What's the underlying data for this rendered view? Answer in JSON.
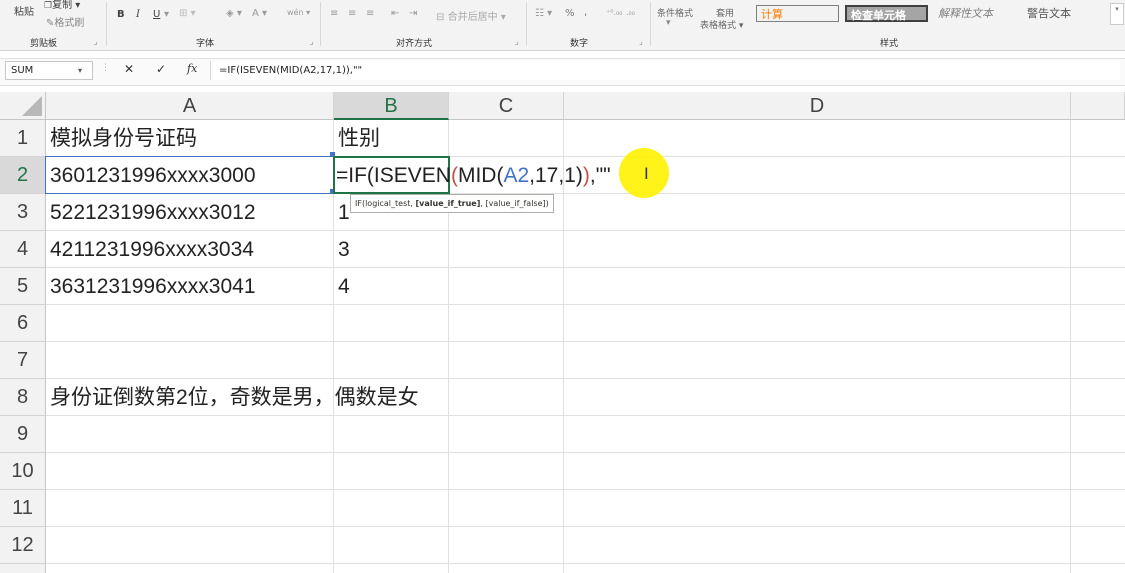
{
  "ribbon": {
    "clipboard": {
      "paste": "粘贴",
      "copy": "复制",
      "format_painter": "格式刷",
      "group_label": "剪贴板"
    },
    "font": {
      "bold": "B",
      "italic": "I",
      "underline": "U",
      "font_color": "A",
      "phonetic": "wén",
      "group_label": "字体"
    },
    "alignment": {
      "merge_center": "合并后居中",
      "group_label": "对齐方式"
    },
    "number": {
      "percent": "%",
      "comma": ",",
      "group_label": "数字"
    },
    "styles": {
      "conditional_format": "条件格式",
      "format_as_table_line1": "套用",
      "format_as_table_line2": "表格格式",
      "calc": "计算",
      "check_cell": "检查单元格",
      "explanatory": "解释性文本",
      "warning": "警告文本",
      "group_label": "样式",
      "colors": {
        "calc_bg": "#f2f2f2",
        "calc_fg": "#fa7d00",
        "check_bg": "#a5a5a5",
        "check_fg": "#ffffff",
        "explanatory_fg": "#7f7f7f",
        "warning_fg": "#555555"
      }
    }
  },
  "formula_bar": {
    "name_box": "SUM",
    "cancel_icon": "✕",
    "enter_icon": "✓",
    "fx": "fx",
    "formula": "=IF(ISEVEN(MID(A2,17,1)),\"\""
  },
  "grid": {
    "columns": [
      "A",
      "B",
      "C",
      "D"
    ],
    "rows": [
      "1",
      "2",
      "3",
      "4",
      "5",
      "6",
      "7",
      "8",
      "9",
      "10",
      "11",
      "12"
    ],
    "cells": {
      "A1": "模拟身份号证码",
      "B1": "性别",
      "A2": "3601231996xxxx3000",
      "A3": "5221231996xxxx3012",
      "B3": "1",
      "A4": "4211231996xxxx3034",
      "B4": "3",
      "A5": "3631231996xxxx3041",
      "B5": "4",
      "A8": "身份证倒数第2位，奇数是男，偶数是女"
    },
    "editing_formula": {
      "eq": "=IF(ISEVEN",
      "p1": "(",
      "mid": "MID(",
      "ref": "A2",
      "args": ",17,1)",
      "p2": ")",
      "tail": ",",
      "quotes": "\"\""
    },
    "tooltip": {
      "fn": "IF(logical_test, ",
      "active": "[value_if_true]",
      "rest": ", [value_if_false])"
    },
    "colors": {
      "ref": "#4472c4",
      "paren": "#c0504d",
      "selection": "#217346",
      "cursor_highlight": "#ffff00"
    }
  }
}
